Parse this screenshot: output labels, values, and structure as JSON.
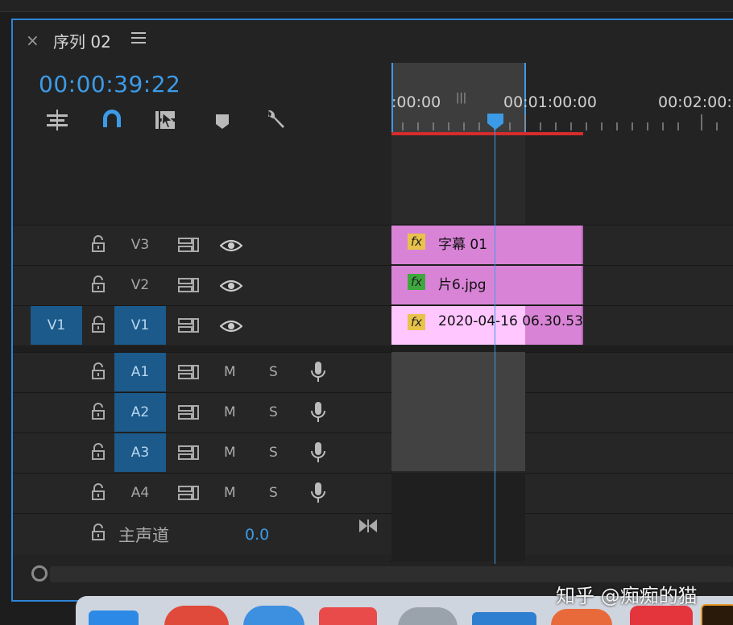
{
  "panel": {
    "close_label": "×",
    "title": "序列 02",
    "timecode": "00:00:39:22"
  },
  "ruler": {
    "labels": [
      ":00:00",
      "00:01:00:00",
      "00:02:00:0"
    ]
  },
  "tracks": {
    "video": [
      {
        "id": "V3",
        "source_patch": "",
        "clip_fx": "fx",
        "clip_name": "字幕 01"
      },
      {
        "id": "V2",
        "source_patch": "",
        "clip_fx": "fx",
        "clip_name": "片6.jpg"
      },
      {
        "id": "V1",
        "source_patch": "V1",
        "clip_fx": "fx",
        "clip_name": "2020-04-16 06.30.53"
      }
    ],
    "audio": [
      {
        "id": "A1",
        "mute": "M",
        "solo": "S"
      },
      {
        "id": "A2",
        "mute": "M",
        "solo": "S"
      },
      {
        "id": "A3",
        "mute": "M",
        "solo": "S"
      },
      {
        "id": "A4",
        "mute": "M",
        "solo": "S"
      }
    ],
    "master": {
      "label": "主声道",
      "value": "0.0"
    }
  },
  "colors": {
    "accent": "#3c9be8",
    "clip": "#d983d7",
    "track_target": "#1b5a8a",
    "work_area_bar": "#d62c2c",
    "fx_yellow": "#e8c24a",
    "fx_green": "#3ea83e"
  },
  "watermark": "知乎 @痴痴的猫"
}
